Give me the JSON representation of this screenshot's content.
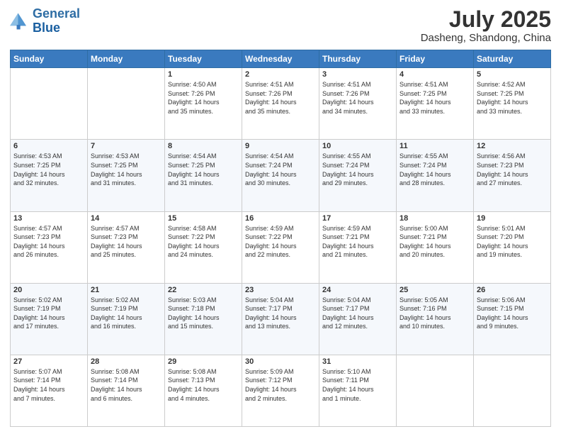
{
  "logo": {
    "line1": "General",
    "line2": "Blue"
  },
  "title": "July 2025",
  "subtitle": "Dasheng, Shandong, China",
  "header_days": [
    "Sunday",
    "Monday",
    "Tuesday",
    "Wednesday",
    "Thursday",
    "Friday",
    "Saturday"
  ],
  "weeks": [
    [
      {
        "day": "",
        "info": ""
      },
      {
        "day": "",
        "info": ""
      },
      {
        "day": "1",
        "info": "Sunrise: 4:50 AM\nSunset: 7:26 PM\nDaylight: 14 hours\nand 35 minutes."
      },
      {
        "day": "2",
        "info": "Sunrise: 4:51 AM\nSunset: 7:26 PM\nDaylight: 14 hours\nand 35 minutes."
      },
      {
        "day": "3",
        "info": "Sunrise: 4:51 AM\nSunset: 7:26 PM\nDaylight: 14 hours\nand 34 minutes."
      },
      {
        "day": "4",
        "info": "Sunrise: 4:51 AM\nSunset: 7:25 PM\nDaylight: 14 hours\nand 33 minutes."
      },
      {
        "day": "5",
        "info": "Sunrise: 4:52 AM\nSunset: 7:25 PM\nDaylight: 14 hours\nand 33 minutes."
      }
    ],
    [
      {
        "day": "6",
        "info": "Sunrise: 4:53 AM\nSunset: 7:25 PM\nDaylight: 14 hours\nand 32 minutes."
      },
      {
        "day": "7",
        "info": "Sunrise: 4:53 AM\nSunset: 7:25 PM\nDaylight: 14 hours\nand 31 minutes."
      },
      {
        "day": "8",
        "info": "Sunrise: 4:54 AM\nSunset: 7:25 PM\nDaylight: 14 hours\nand 31 minutes."
      },
      {
        "day": "9",
        "info": "Sunrise: 4:54 AM\nSunset: 7:24 PM\nDaylight: 14 hours\nand 30 minutes."
      },
      {
        "day": "10",
        "info": "Sunrise: 4:55 AM\nSunset: 7:24 PM\nDaylight: 14 hours\nand 29 minutes."
      },
      {
        "day": "11",
        "info": "Sunrise: 4:55 AM\nSunset: 7:24 PM\nDaylight: 14 hours\nand 28 minutes."
      },
      {
        "day": "12",
        "info": "Sunrise: 4:56 AM\nSunset: 7:23 PM\nDaylight: 14 hours\nand 27 minutes."
      }
    ],
    [
      {
        "day": "13",
        "info": "Sunrise: 4:57 AM\nSunset: 7:23 PM\nDaylight: 14 hours\nand 26 minutes."
      },
      {
        "day": "14",
        "info": "Sunrise: 4:57 AM\nSunset: 7:23 PM\nDaylight: 14 hours\nand 25 minutes."
      },
      {
        "day": "15",
        "info": "Sunrise: 4:58 AM\nSunset: 7:22 PM\nDaylight: 14 hours\nand 24 minutes."
      },
      {
        "day": "16",
        "info": "Sunrise: 4:59 AM\nSunset: 7:22 PM\nDaylight: 14 hours\nand 22 minutes."
      },
      {
        "day": "17",
        "info": "Sunrise: 4:59 AM\nSunset: 7:21 PM\nDaylight: 14 hours\nand 21 minutes."
      },
      {
        "day": "18",
        "info": "Sunrise: 5:00 AM\nSunset: 7:21 PM\nDaylight: 14 hours\nand 20 minutes."
      },
      {
        "day": "19",
        "info": "Sunrise: 5:01 AM\nSunset: 7:20 PM\nDaylight: 14 hours\nand 19 minutes."
      }
    ],
    [
      {
        "day": "20",
        "info": "Sunrise: 5:02 AM\nSunset: 7:19 PM\nDaylight: 14 hours\nand 17 minutes."
      },
      {
        "day": "21",
        "info": "Sunrise: 5:02 AM\nSunset: 7:19 PM\nDaylight: 14 hours\nand 16 minutes."
      },
      {
        "day": "22",
        "info": "Sunrise: 5:03 AM\nSunset: 7:18 PM\nDaylight: 14 hours\nand 15 minutes."
      },
      {
        "day": "23",
        "info": "Sunrise: 5:04 AM\nSunset: 7:17 PM\nDaylight: 14 hours\nand 13 minutes."
      },
      {
        "day": "24",
        "info": "Sunrise: 5:04 AM\nSunset: 7:17 PM\nDaylight: 14 hours\nand 12 minutes."
      },
      {
        "day": "25",
        "info": "Sunrise: 5:05 AM\nSunset: 7:16 PM\nDaylight: 14 hours\nand 10 minutes."
      },
      {
        "day": "26",
        "info": "Sunrise: 5:06 AM\nSunset: 7:15 PM\nDaylight: 14 hours\nand 9 minutes."
      }
    ],
    [
      {
        "day": "27",
        "info": "Sunrise: 5:07 AM\nSunset: 7:14 PM\nDaylight: 14 hours\nand 7 minutes."
      },
      {
        "day": "28",
        "info": "Sunrise: 5:08 AM\nSunset: 7:14 PM\nDaylight: 14 hours\nand 6 minutes."
      },
      {
        "day": "29",
        "info": "Sunrise: 5:08 AM\nSunset: 7:13 PM\nDaylight: 14 hours\nand 4 minutes."
      },
      {
        "day": "30",
        "info": "Sunrise: 5:09 AM\nSunset: 7:12 PM\nDaylight: 14 hours\nand 2 minutes."
      },
      {
        "day": "31",
        "info": "Sunrise: 5:10 AM\nSunset: 7:11 PM\nDaylight: 14 hours\nand 1 minute."
      },
      {
        "day": "",
        "info": ""
      },
      {
        "day": "",
        "info": ""
      }
    ]
  ]
}
